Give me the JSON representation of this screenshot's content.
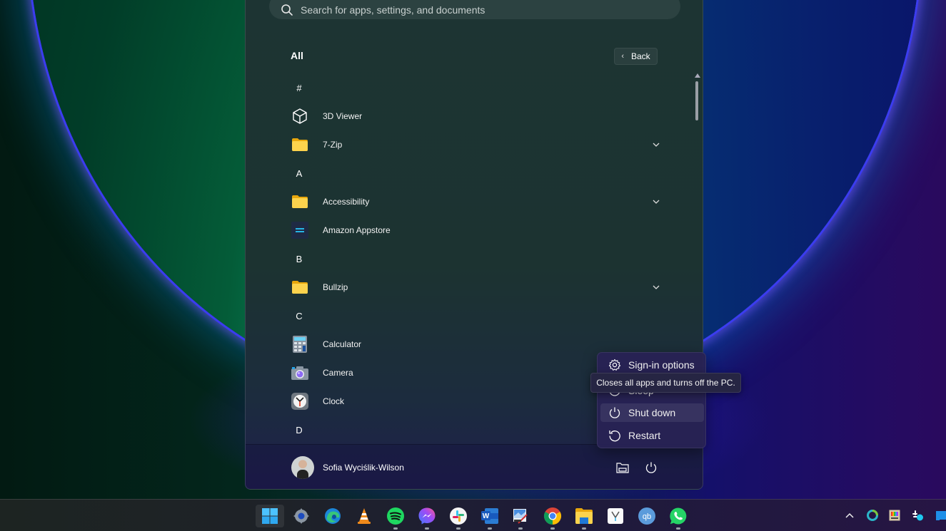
{
  "search": {
    "placeholder": "Search for apps, settings, and documents"
  },
  "start_menu": {
    "section_title": "All",
    "back_label": "Back",
    "rows": [
      {
        "type": "letter",
        "label": "#"
      },
      {
        "type": "app",
        "label": "3D Viewer",
        "icon": "cube-icon"
      },
      {
        "type": "folder",
        "label": "7-Zip",
        "icon": "folder-icon",
        "expandable": true
      },
      {
        "type": "letter",
        "label": "A"
      },
      {
        "type": "folder",
        "label": "Accessibility",
        "icon": "folder-icon",
        "expandable": true
      },
      {
        "type": "app",
        "label": "Amazon Appstore",
        "icon": "amazon-appstore-icon"
      },
      {
        "type": "letter",
        "label": "B"
      },
      {
        "type": "folder",
        "label": "Bullzip",
        "icon": "folder-icon",
        "expandable": true
      },
      {
        "type": "letter",
        "label": "C"
      },
      {
        "type": "app",
        "label": "Calculator",
        "icon": "calculator-icon"
      },
      {
        "type": "app",
        "label": "Camera",
        "icon": "camera-icon"
      },
      {
        "type": "app",
        "label": "Clock",
        "icon": "clock-icon"
      },
      {
        "type": "letter",
        "label": "D"
      }
    ],
    "user": {
      "name": "Sofia Wyciślik-Wilson"
    }
  },
  "power_menu": {
    "items": [
      {
        "label": "Sign-in options",
        "icon": "gear-icon"
      },
      {
        "label": "Sleep",
        "icon": "sleep-icon"
      },
      {
        "label": "Shut down",
        "icon": "power-icon",
        "hovered": true
      },
      {
        "label": "Restart",
        "icon": "restart-icon"
      }
    ],
    "tooltip": "Closes all apps and turns off the PC."
  },
  "taskbar": {
    "pinned": [
      {
        "name": "start",
        "icon": "windows-logo-icon",
        "active": true,
        "running": false
      },
      {
        "name": "settings",
        "icon": "settings-gear-icon",
        "running": false
      },
      {
        "name": "edge",
        "icon": "edge-icon",
        "running": false
      },
      {
        "name": "vlc",
        "icon": "vlc-icon",
        "running": false
      },
      {
        "name": "spotify",
        "icon": "spotify-icon",
        "running": true
      },
      {
        "name": "messenger",
        "icon": "messenger-icon",
        "running": true
      },
      {
        "name": "slack",
        "icon": "slack-icon",
        "running": true
      },
      {
        "name": "word",
        "icon": "word-icon",
        "running": true
      },
      {
        "name": "paint",
        "icon": "paint-icon",
        "running": true
      },
      {
        "name": "chrome",
        "icon": "chrome-icon",
        "running": true
      },
      {
        "name": "file-explorer",
        "icon": "folder-icon",
        "running": true
      },
      {
        "name": "vivaldi",
        "icon": "vivaldi-icon",
        "running": false
      },
      {
        "name": "qbittorrent",
        "icon": "qbittorrent-icon",
        "running": false
      },
      {
        "name": "whatsapp",
        "icon": "whatsapp-icon",
        "running": true
      }
    ],
    "tray": [
      {
        "name": "show-hidden",
        "icon": "chevron-up-icon"
      },
      {
        "name": "sync",
        "icon": "ring-icon"
      },
      {
        "name": "colour-app",
        "icon": "palette-icon"
      },
      {
        "name": "slack-tray",
        "icon": "slack-notify-icon"
      },
      {
        "name": "app-tray",
        "icon": "blue-app-icon"
      }
    ]
  },
  "colors": {
    "accent": "#4cc2ff",
    "folder": "#f5c842"
  }
}
